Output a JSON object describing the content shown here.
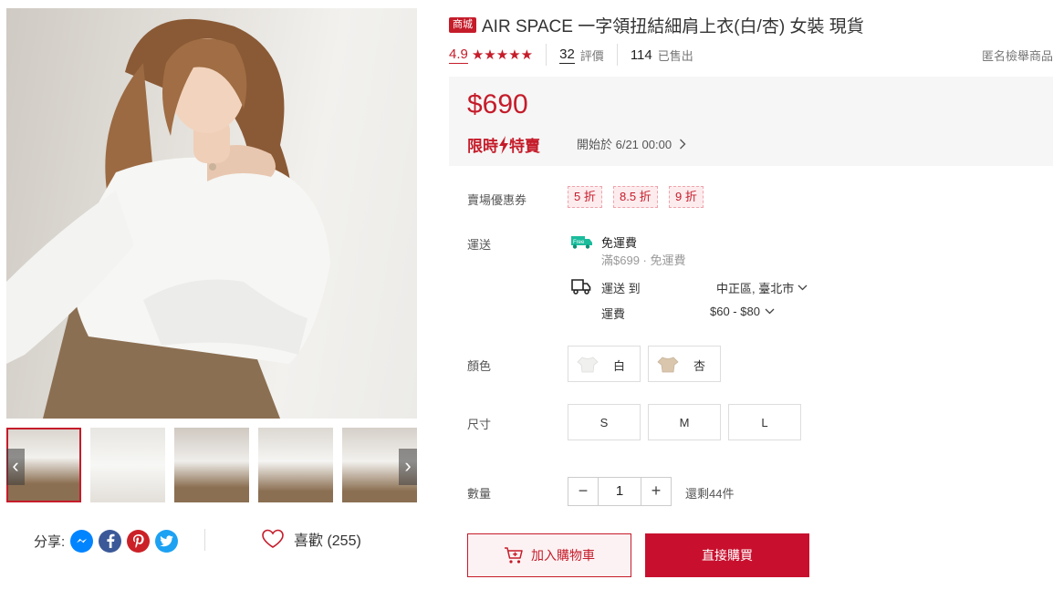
{
  "gallery": {
    "prev_arrow": "‹",
    "next_arrow": "›"
  },
  "share": {
    "label": "分享:",
    "networks": [
      "messenger-icon",
      "facebook-icon",
      "pinterest-icon",
      "twitter-icon"
    ]
  },
  "like": {
    "label": "喜歡 (255)"
  },
  "product": {
    "badge": "商城",
    "title": "AIR SPACE 一字領扭結細肩上衣(白/杏) 女裝 現貨",
    "rating": "4.9",
    "stars": "★★★★★",
    "review_count": "32",
    "review_label": "評價",
    "sold_count": "114",
    "sold_label": "已售出",
    "report": "匿名檢舉商品"
  },
  "pricing": {
    "price": "$690",
    "flash_left": "限時",
    "flash_right": "特賣",
    "start_text": "開始於 6/21 00:00",
    "accent": "#c51c2a"
  },
  "coupons": {
    "label": "賣場優惠券",
    "items": [
      "5 折",
      "8.5 折",
      "9 折"
    ]
  },
  "shipping": {
    "label": "運送",
    "free_title": "免運費",
    "free_sub": "滿$699 · 免運費",
    "to_label": "運送 到",
    "location": "中正區, 臺北市",
    "fee_label": "運費",
    "fee_range": "$60 - $80"
  },
  "color": {
    "label": "顏色",
    "options": [
      "白",
      "杏"
    ]
  },
  "size": {
    "label": "尺寸",
    "options": [
      "S",
      "M",
      "L"
    ]
  },
  "quantity": {
    "label": "數量",
    "minus": "−",
    "value": "1",
    "plus": "+",
    "stock": "還剩44件"
  },
  "actions": {
    "add_to_cart": "加入購物車",
    "buy_now": "直接購買"
  }
}
